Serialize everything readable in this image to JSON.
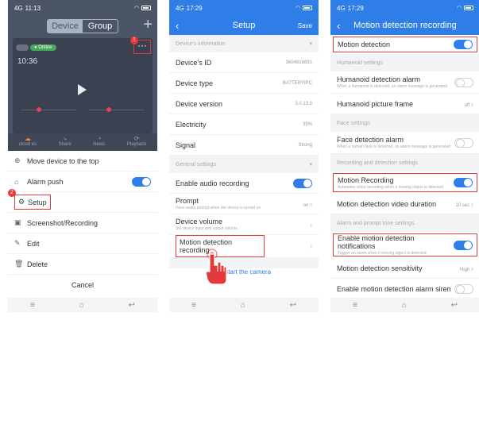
{
  "status": {
    "p1_time": "11:13",
    "p2_time": "17:29",
    "p3_time": "17:29",
    "signal": "4G"
  },
  "phone1": {
    "tabs": [
      "Device",
      "Group"
    ],
    "online": "Online",
    "badge_1": "1",
    "badge_2": "2",
    "overlay_time": "10:36",
    "actions": [
      "cloud es",
      "Share",
      "News",
      "Playback"
    ],
    "menu": {
      "move_top": "Move device to the top",
      "alarm_push": "Alarm push",
      "setup": "Setup",
      "screenshot": "Screenshot/Recording",
      "edit": "Edit",
      "delete": "Delete"
    },
    "cancel": "Cancel"
  },
  "phone2": {
    "title": "Setup",
    "save": "Save",
    "section_device": "Device's information",
    "device_id_label": "Device's ID",
    "device_id_value": "3604816891",
    "device_type_label": "Device type",
    "device_type_value": "BATTERYIPC",
    "device_version_label": "Device version",
    "device_version_value": "3.0.13.0",
    "electricity_label": "Electricity",
    "electricity_value": "39%",
    "signal_label": "Signal",
    "signal_value": "Strong",
    "section_general": "General settings",
    "audio_rec": "Enable audio recording",
    "prompt_label": "Prompt",
    "prompt_sub": "Have audio prompt when the device is turned on",
    "prompt_value": "on",
    "volume_label": "Device volume",
    "volume_sub": "Set device input and output volume",
    "motion_rec": "Motion detection recording",
    "restart": "Restart the camera"
  },
  "phone3": {
    "title": "Motion detection recording",
    "motion_detection": "Motion detection",
    "section_humanoid": "Humanoid settings",
    "humanoid_alarm": "Humanoid detection alarm",
    "humanoid_alarm_sub": "When a humanoid is detected, an alarm message is generated",
    "humanoid_frame": "Humanoid picture frame",
    "humanoid_frame_value": "off",
    "section_face": "Face settings",
    "face_alarm": "Face detection alarm",
    "face_alarm_sub": "When a human face is detected, an alarm message is generated",
    "section_recording": "Recording and detection settings",
    "motion_recording": "Motion Recording",
    "motion_recording_sub": "Automatic video recording when a moving object is detected",
    "video_duration": "Motion detection video duration",
    "video_duration_value": "10 sec",
    "section_alarm": "Alarm and prompt tone settings",
    "enable_notif": "Enable motion detection notifications",
    "enable_notif_sub": "Trigger an alarm when it moving object is detected",
    "sensitivity": "Motion detection sensitivity",
    "sensitivity_value": "High",
    "siren": "Enable motion detection alarm siren"
  },
  "colors": {
    "accent": "#2f7ee8",
    "highlight": "#e23a3a",
    "p1_header": "#4b5566"
  },
  "icons": [
    "menu-icon",
    "home-icon",
    "back-icon",
    "pointing-hand-icon",
    "chevron-right-icon",
    "more-icon"
  ]
}
